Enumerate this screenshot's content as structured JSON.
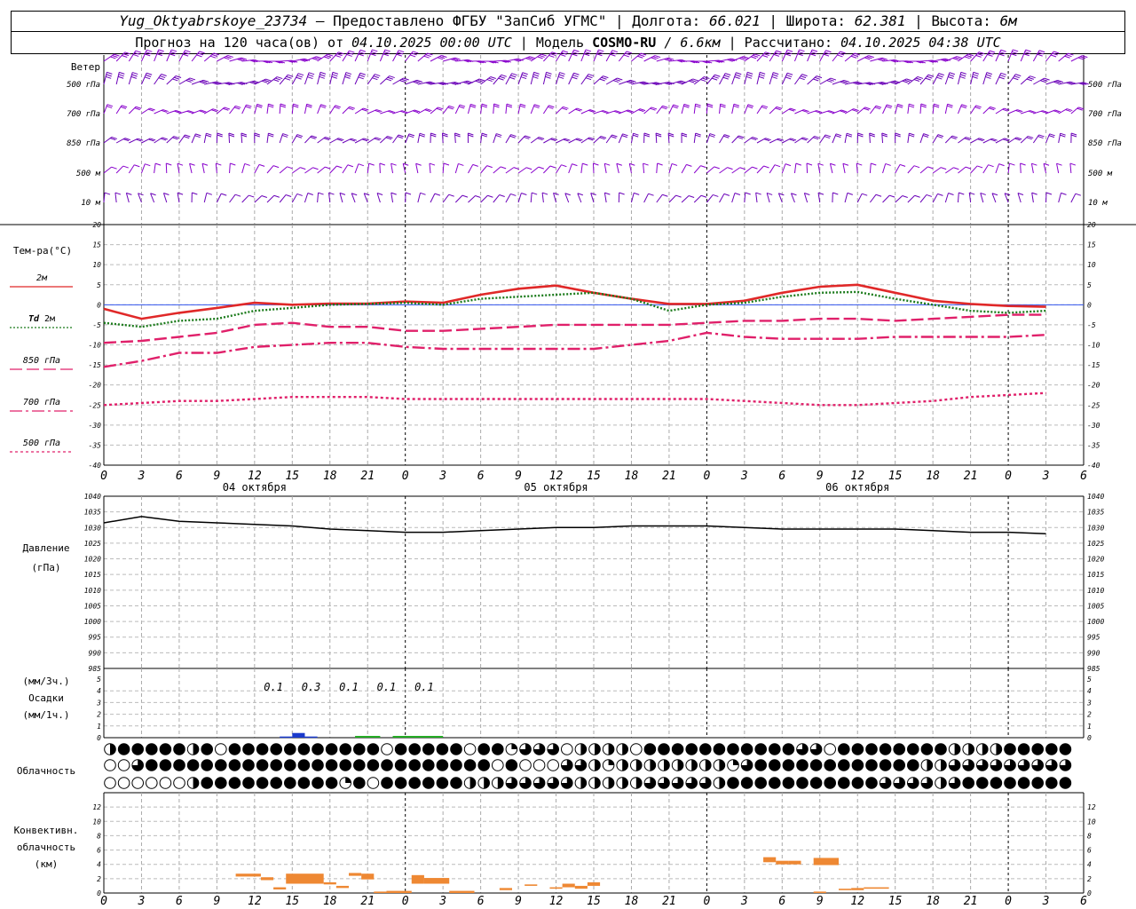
{
  "header": {
    "station": "Yug_Oktyabrskoye_23734",
    "provided_label": " – Предоставлено ФГБУ \"ЗапСиб УГМС\" | Долгота: ",
    "longitude": "66.021",
    "lat_label": " | Широта: ",
    "latitude": "62.381",
    "alt_label": " | Высота: ",
    "altitude": "6м",
    "forecast_label": "Прогноз на 120 часа(ов) от ",
    "forecast_start": "04.10.2025 00:00 UTC",
    "model_label": " | Модель ",
    "model": "COSMO-RU",
    "resolution": " / 6.6км",
    "calc_label": " | Рассчитано: ",
    "calc_time": "04.10.2025 04:38 UTC"
  },
  "chart_data": [
    {
      "type": "wind-barbs",
      "panel_label": "Ветер",
      "levels": [
        "500 гПа",
        "700 гПа",
        "850 гПа",
        "500 м",
        "10 м"
      ],
      "colors": [
        "#8800cc",
        "#6a00b8"
      ]
    },
    {
      "type": "line",
      "ylabel": "Тем-ра(°C)",
      "ylim": [
        -40,
        20
      ],
      "yticks": [
        20,
        15,
        10,
        5,
        0,
        -5,
        -10,
        -15,
        -20,
        -25,
        -30,
        -35,
        -40
      ],
      "x_hours": [
        0,
        3,
        6,
        9,
        12,
        15,
        18,
        21,
        24,
        27,
        30,
        33,
        36,
        39,
        42,
        45,
        48,
        51,
        54,
        57,
        60,
        63,
        66,
        69,
        72,
        75
      ],
      "series": [
        {
          "name": "2м",
          "color": "#e02828",
          "dash": "none",
          "values": [
            -1,
            -3.5,
            -2,
            -0.8,
            0.5,
            0,
            0.3,
            0.3,
            0.8,
            0.5,
            2.5,
            4,
            4.8,
            3,
            1.5,
            0.2,
            0.2,
            1,
            3,
            4.5,
            5,
            3,
            1,
            0.2,
            -0.3,
            -0.5
          ]
        },
        {
          "name": "Td",
          "label_suffix": " 2м",
          "color": "#1a7a1a",
          "dash": "2,2",
          "values": [
            -4.5,
            -5.5,
            -4,
            -3.5,
            -1.5,
            -0.8,
            0,
            0.2,
            0.5,
            0,
            1.5,
            2,
            2.5,
            3,
            1.5,
            -1.5,
            0,
            0.5,
            2,
            3,
            3.2,
            1.5,
            0,
            -1.5,
            -2,
            -1.5
          ]
        },
        {
          "name": "850 гПа",
          "color": "#e0206a",
          "dash": "14,5",
          "values": [
            -9.5,
            -9,
            -8,
            -7,
            -5,
            -4.5,
            -5.5,
            -5.5,
            -6.5,
            -6.5,
            -6,
            -5.5,
            -5,
            -5,
            -5,
            -5,
            -4.5,
            -4,
            -4,
            -3.5,
            -3.5,
            -4,
            -3.5,
            -3,
            -2.5,
            -2.5
          ]
        },
        {
          "name": "700 гПа",
          "color": "#e0206a",
          "dash": "14,4,3,4",
          "values": [
            -15.5,
            -14,
            -12,
            -12,
            -10.5,
            -10,
            -9.5,
            -9.5,
            -10.5,
            -11,
            -11,
            -11,
            -11,
            -11,
            -10,
            -9,
            -7,
            -8,
            -8.5,
            -8.5,
            -8.5,
            -8,
            -8,
            -8,
            -8,
            -7.5
          ]
        },
        {
          "name": "500 гПа",
          "color": "#e0206a",
          "dash": "3,3",
          "values": [
            -25,
            -24.5,
            -24,
            -24,
            -23.5,
            -23,
            -23,
            -23,
            -23.5,
            -23.5,
            -23.5,
            -23.5,
            -23.5,
            -23.5,
            -23.5,
            -23.5,
            -23.5,
            -24,
            -24.5,
            -25,
            -25,
            -24.5,
            -24,
            -23,
            -22.5,
            -22
          ]
        }
      ]
    },
    {
      "type": "line",
      "ylabel": "Давление",
      "yunit": "(гПа)",
      "ylim": [
        985,
        1040
      ],
      "yticks": [
        1040,
        1035,
        1030,
        1025,
        1020,
        1015,
        1010,
        1005,
        1000,
        995,
        990,
        985
      ],
      "x_hours": [
        0,
        3,
        6,
        9,
        12,
        15,
        18,
        21,
        24,
        27,
        30,
        33,
        36,
        39,
        42,
        45,
        48,
        51,
        54,
        57,
        60,
        63,
        66,
        69,
        72,
        75
      ],
      "values": [
        1031.5,
        1033.5,
        1032,
        1031.5,
        1031,
        1030.5,
        1029.5,
        1029,
        1028.5,
        1028.5,
        1029,
        1029.5,
        1030,
        1030,
        1030.5,
        1030.5,
        1030.5,
        1030,
        1029.5,
        1029.5,
        1029.5,
        1029.5,
        1029,
        1028.5,
        1028.5,
        1028
      ]
    },
    {
      "type": "bar",
      "ylabel_top": "(мм/3ч.)",
      "ylabel_mid": "Осадки",
      "ylabel_bot": "(мм/1ч.)",
      "ylim": [
        0,
        5
      ],
      "yticks": [
        5,
        4,
        3,
        2,
        1,
        0
      ],
      "labels": [
        {
          "hour": 13.5,
          "text": "0.1"
        },
        {
          "hour": 16.5,
          "text": "0.3"
        },
        {
          "hour": 19.5,
          "text": "0.1"
        },
        {
          "hour": 22.5,
          "text": "0.1"
        },
        {
          "hour": 25.5,
          "text": "0.1"
        }
      ],
      "bars": [
        {
          "start": 14,
          "end": 15,
          "value": 0.1,
          "color": "#1a3acc"
        },
        {
          "start": 15,
          "end": 16,
          "value": 0.4,
          "color": "#1a3acc"
        },
        {
          "start": 16,
          "end": 17,
          "value": 0.1,
          "color": "#1a3acc"
        },
        {
          "start": 20,
          "end": 22,
          "value": 0.15,
          "color": "#22aa22"
        },
        {
          "start": 23,
          "end": 27,
          "value": 0.15,
          "color": "#22aa22"
        }
      ]
    },
    {
      "type": "cloud-symbols",
      "label": "Облачность",
      "rows": [
        "2444442404444444444404444404413330222204444444444433044444444222244444",
        "0034444444444444444444444444040003321222222221344444444444422333333333",
        "0000002444444444414044444422233333222223333324444444444433332344444444"
      ]
    },
    {
      "type": "bar",
      "ylabel": "Конвективн.",
      "ylabel2": "облачность",
      "yunit": "(км)",
      "ylim": [
        0,
        14
      ],
      "yticks": [
        12,
        10,
        8,
        6,
        4,
        2,
        0
      ],
      "color": "#ee8833",
      "segments": [
        [
          10.5,
          12.5,
          2.3,
          2.7
        ],
        [
          12.5,
          13.5,
          1.8,
          2.2
        ],
        [
          13.5,
          14.5,
          0.5,
          0.8
        ],
        [
          14.5,
          17.5,
          1.3,
          2.7
        ],
        [
          17.5,
          18.5,
          1.2,
          1.5
        ],
        [
          18.5,
          19.5,
          0.7,
          1.0
        ],
        [
          19.5,
          20.5,
          2.4,
          2.8
        ],
        [
          20.5,
          21.5,
          1.9,
          2.7
        ],
        [
          21.5,
          22.5,
          0.0,
          0.2
        ],
        [
          22.5,
          24.5,
          0.0,
          0.3
        ],
        [
          24.5,
          25.5,
          1.3,
          2.5
        ],
        [
          25.5,
          27.5,
          1.3,
          2.1
        ],
        [
          27.5,
          29.5,
          0.0,
          0.3
        ],
        [
          31.5,
          32.5,
          0.4,
          0.7
        ],
        [
          33.5,
          34.5,
          1.0,
          1.2
        ],
        [
          35.5,
          36.5,
          0.6,
          0.8
        ],
        [
          36.5,
          37.5,
          0.8,
          1.3
        ],
        [
          37.5,
          38.5,
          0.6,
          1.0
        ],
        [
          38.5,
          39.5,
          1.0,
          1.5
        ],
        [
          52.5,
          53.5,
          4.3,
          5.0
        ],
        [
          53.5,
          54.5,
          4.0,
          4.5
        ],
        [
          54.5,
          55.5,
          4.0,
          4.5
        ],
        [
          56.5,
          58.5,
          3.9,
          4.9
        ],
        [
          56.5,
          57.5,
          0.0,
          0.2
        ],
        [
          58.5,
          59.5,
          0.4,
          0.6
        ],
        [
          59.5,
          60.5,
          0.4,
          0.7
        ],
        [
          60.5,
          62.5,
          0.6,
          0.8
        ]
      ]
    }
  ],
  "xaxis": {
    "tick_labels": [
      "0",
      "3",
      "6",
      "9",
      "12",
      "15",
      "18",
      "21"
    ],
    "last_label": "6",
    "days": [
      "04 октября",
      "05 октября",
      "06 октября"
    ]
  }
}
